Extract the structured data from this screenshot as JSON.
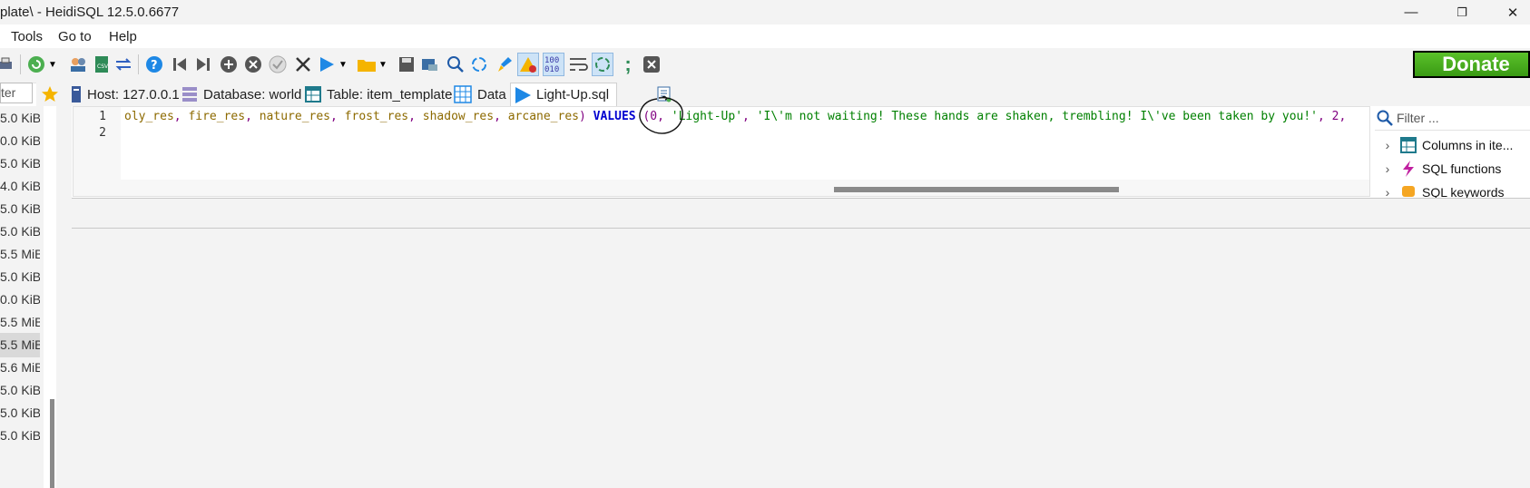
{
  "window": {
    "title": "plate\\ - HeidiSQL 12.5.0.6677",
    "controls": [
      "—",
      "❐",
      "✕"
    ]
  },
  "menu": [
    "Tools",
    "Go to",
    "Help"
  ],
  "donate_label": "Donate",
  "left_filter_text": "ter",
  "tabs": [
    {
      "label": "Host: 127.0.0.1",
      "icon": "host-icon"
    },
    {
      "label": "Database: world",
      "icon": "database-icon"
    },
    {
      "label": "Table: item_template",
      "icon": "table-icon"
    },
    {
      "label": "Data",
      "icon": "data-grid-icon"
    },
    {
      "label": "Light-Up.sql",
      "icon": "play-icon",
      "active": true
    }
  ],
  "sizes": [
    "5.0 KiB",
    "0.0 KiB",
    "5.0 KiB",
    "4.0 KiB",
    "5.0 KiB",
    "5.0 KiB",
    "5.5 MiB",
    "5.0 KiB",
    "0.0 KiB",
    "5.5 MiB",
    "5.5 MiB",
    "5.6 MiB",
    "5.0 KiB",
    "5.0 KiB",
    "5.0 KiB"
  ],
  "selected_size_index": 10,
  "editor": {
    "line_numbers": [
      "1",
      "2"
    ],
    "line1": {
      "columns": [
        "oly_res",
        "fire_res",
        "nature_res",
        "frost_res",
        "shadow_res",
        "arcane_res"
      ],
      "keyword": "VALUES",
      "open_paren": "(",
      "first_value": "0",
      "str1": "'Light-Up'",
      "str2": "'I\\'m not waiting! These hands are shaken, trembling! I\\'ve been taken by you!'",
      "tail_num": "2"
    }
  },
  "helper": {
    "filter_placeholder": "Filter ...",
    "items": [
      {
        "label": "Columns in ite...",
        "icon": "columns-icon"
      },
      {
        "label": "SQL functions",
        "icon": "lightning-icon"
      },
      {
        "label": "SQL keywords",
        "icon": "keyword-icon"
      }
    ]
  },
  "colors": {
    "keyword": "#0000d0",
    "string": "#008000",
    "identifier": "#8d6a00",
    "number": "#800080",
    "donate_green": "#4caf1f"
  }
}
